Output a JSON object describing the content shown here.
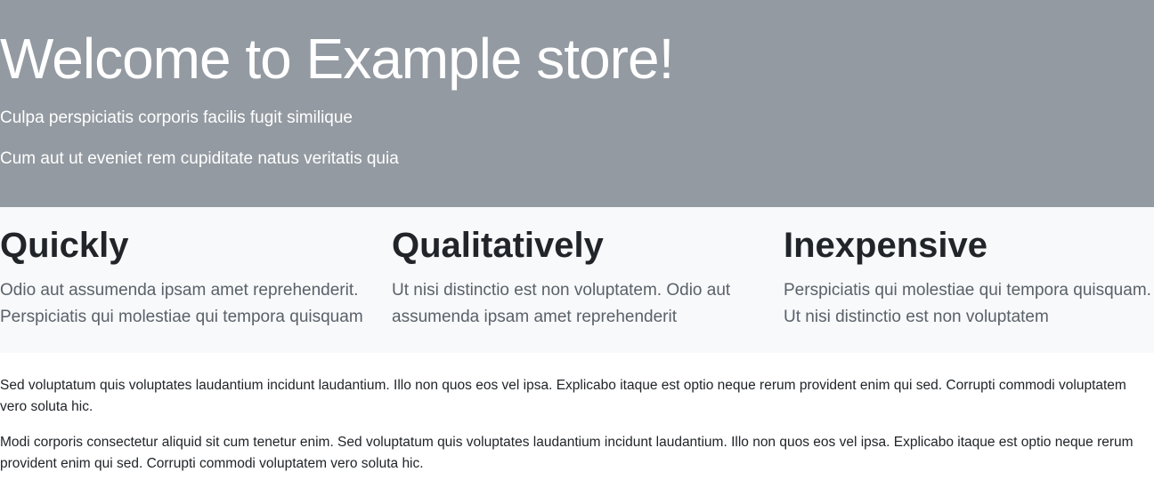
{
  "hero": {
    "title": "Welcome to Example store!",
    "line1": "Culpa perspiciatis corporis facilis fugit similique",
    "line2": "Cum aut ut eveniet rem cupiditate natus veritatis quia",
    "background_color": "#939aa1"
  },
  "features": {
    "background_color": "#f8f9fa",
    "items": [
      {
        "title": "Quickly",
        "text": "Odio aut assumenda ipsam amet reprehenderit. Perspiciatis qui molestiae qui tempora quisquam"
      },
      {
        "title": "Qualitatively",
        "text": "Ut nisi distinctio est non voluptatem. Odio aut assumenda ipsam amet reprehenderit"
      },
      {
        "title": "Inexpensive",
        "text": "Perspiciatis qui molestiae qui tempora quisquam. Ut nisi distinctio est non voluptatem"
      }
    ]
  },
  "content": {
    "paragraphs": [
      "Sed voluptatum quis voluptates laudantium incidunt laudantium. Illo non quos eos vel ipsa. Explicabo itaque est optio neque rerum provident enim qui sed. Corrupti commodi voluptatem vero soluta hic.",
      "Modi corporis consectetur aliquid sit cum tenetur enim. Sed voluptatum quis voluptates laudantium incidunt laudantium. Illo non quos eos vel ipsa. Explicabo itaque est optio neque rerum provident enim qui sed. Corrupti commodi voluptatem vero soluta hic."
    ]
  }
}
